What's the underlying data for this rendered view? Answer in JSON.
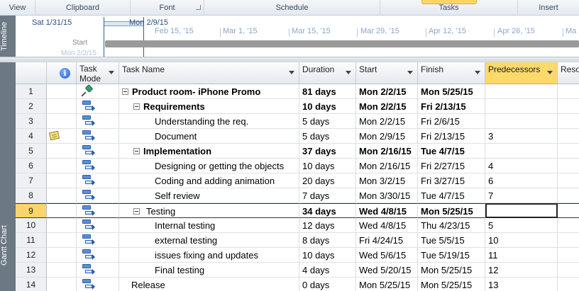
{
  "ribbon": {
    "groups": [
      "View",
      "Clipboard",
      "Font",
      "Schedule",
      "Tasks",
      "Insert"
    ]
  },
  "timeline": {
    "band_label": "Timeline",
    "start_date": "Sat 1/31/15",
    "view_date": "Mon 2/9/15",
    "ticks": [
      "Feb 15, '15",
      "Mar 1, '15",
      "Mar 15, '15",
      "Mar 29, '15",
      "Apr 12, '15",
      "Apr 26, '15",
      "Ma"
    ],
    "start_label": "Start",
    "start_sub": "Mon 2/2/15"
  },
  "gantt": {
    "band_label": "Gantt Chart"
  },
  "columns": {
    "info": "i",
    "mode_line1": "Task",
    "mode_line2": "Mode",
    "name": "Task Name",
    "duration": "Duration",
    "start": "Start",
    "finish": "Finish",
    "predecessors": "Predecessors",
    "resource": "Resou"
  },
  "rows": [
    {
      "id": "1",
      "name": "Product room- iPhone Promo",
      "duration": "81 days",
      "start": "Mon 2/2/15",
      "finish": "Mon 5/25/15",
      "pred": ""
    },
    {
      "id": "2",
      "name": "Requirements",
      "duration": "10 days",
      "start": "Mon 2/2/15",
      "finish": "Fri 2/13/15",
      "pred": ""
    },
    {
      "id": "3",
      "name": "Understanding the req.",
      "duration": "5 days",
      "start": "Mon 2/2/15",
      "finish": "Fri 2/6/15",
      "pred": ""
    },
    {
      "id": "4",
      "name": "Document",
      "duration": "5 days",
      "start": "Mon 2/9/15",
      "finish": "Fri 2/13/15",
      "pred": "3"
    },
    {
      "id": "5",
      "name": "Implementation",
      "duration": "37 days",
      "start": "Mon 2/16/15",
      "finish": "Tue 4/7/15",
      "pred": ""
    },
    {
      "id": "6",
      "name": "Designing or getting the objects",
      "duration": "10 days",
      "start": "Mon 2/16/15",
      "finish": "Fri 2/27/15",
      "pred": "4"
    },
    {
      "id": "7",
      "name": "Coding and adding animation",
      "duration": "20 days",
      "start": "Mon 3/2/15",
      "finish": "Fri 3/27/15",
      "pred": "6"
    },
    {
      "id": "8",
      "name": "Self review",
      "duration": "7 days",
      "start": "Mon 3/30/15",
      "finish": "Tue 4/7/15",
      "pred": "7"
    },
    {
      "id": "9",
      "name": "Testing",
      "duration": "34 days",
      "start": "Wed 4/8/15",
      "finish": "Mon 5/25/15",
      "pred": ""
    },
    {
      "id": "10",
      "name": "Internal testing",
      "duration": "12 days",
      "start": "Wed 4/8/15",
      "finish": "Thu 4/23/15",
      "pred": "5"
    },
    {
      "id": "11",
      "name": "external testing",
      "duration": "8 days",
      "start": "Fri 4/24/15",
      "finish": "Tue 5/5/15",
      "pred": "10"
    },
    {
      "id": "12",
      "name": "issues fixing and updates",
      "duration": "10 days",
      "start": "Wed 5/6/15",
      "finish": "Tue 5/19/15",
      "pred": "11"
    },
    {
      "id": "13",
      "name": "Final testing",
      "duration": "4 days",
      "start": "Wed 5/20/15",
      "finish": "Mon 5/25/15",
      "pred": "12"
    },
    {
      "id": "14",
      "name": "Release",
      "duration": "0 days",
      "start": "Mon 5/25/15",
      "finish": "Mon 5/25/15",
      "pred": "13"
    }
  ]
}
